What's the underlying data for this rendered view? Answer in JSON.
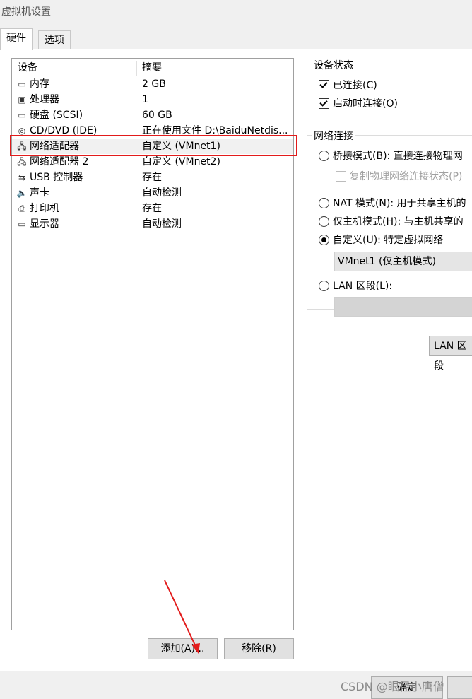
{
  "window": {
    "title": "虚拟机设置"
  },
  "tabs": [
    {
      "label": "硬件"
    },
    {
      "label": "选项"
    }
  ],
  "devices": {
    "header": {
      "device": "设备",
      "summary": "摘要"
    },
    "items": [
      {
        "name": "内存",
        "summary": "2 GB",
        "icon": "memory-icon"
      },
      {
        "name": "处理器",
        "summary": "1",
        "icon": "cpu-icon"
      },
      {
        "name": "硬盘 (SCSI)",
        "summary": "60 GB",
        "icon": "harddisk-icon"
      },
      {
        "name": "CD/DVD (IDE)",
        "summary": "正在使用文件 D:\\BaiduNetdis...",
        "icon": "cd-icon"
      },
      {
        "name": "网络适配器",
        "summary": "自定义 (VMnet1)",
        "icon": "network-icon"
      },
      {
        "name": "网络适配器 2",
        "summary": "自定义 (VMnet2)",
        "icon": "network-icon"
      },
      {
        "name": "USB 控制器",
        "summary": "存在",
        "icon": "usb-icon"
      },
      {
        "name": "声卡",
        "summary": "自动检测",
        "icon": "speaker-icon"
      },
      {
        "name": "打印机",
        "summary": "存在",
        "icon": "printer-icon"
      },
      {
        "name": "显示器",
        "summary": "自动检测",
        "icon": "monitor-icon"
      }
    ],
    "selected_index": 4
  },
  "buttons": {
    "add": "添加(A)...",
    "remove": "移除(R)",
    "ok": "确定",
    "lan_segments": "LAN 区段"
  },
  "device_status": {
    "title": "设备状态",
    "connected": {
      "label": "已连接(C)",
      "checked": true
    },
    "connect_at_power_on": {
      "label": "启动时连接(O)",
      "checked": true
    }
  },
  "network_connection": {
    "title": "网络连接",
    "bridged": {
      "label": "桥接模式(B): 直接连接物理网",
      "checked": false
    },
    "replicate": {
      "label": "复制物理网络连接状态(P)",
      "checked": false,
      "disabled": true
    },
    "nat": {
      "label": "NAT 模式(N): 用于共享主机的",
      "checked": false
    },
    "host_only": {
      "label": "仅主机模式(H): 与主机共享的",
      "checked": false
    },
    "custom": {
      "label": "自定义(U): 特定虚拟网络",
      "checked": true
    },
    "custom_select_value": "VMnet1 (仅主机模式)",
    "lan_segment": {
      "label": "LAN 区段(L):",
      "checked": false
    }
  },
  "watermark": "CSDN @眼径小唐僧",
  "colors": {
    "highlight_border": "#e21b1b",
    "arrow": "#e21b1b"
  }
}
